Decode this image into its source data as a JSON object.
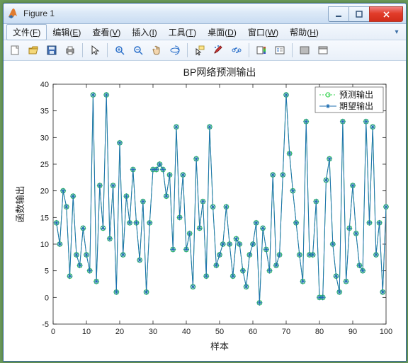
{
  "window": {
    "title": "Figure 1"
  },
  "menu": {
    "file": {
      "label": "文件",
      "accel": "F"
    },
    "edit": {
      "label": "编辑",
      "accel": "E"
    },
    "view": {
      "label": "查看",
      "accel": "V"
    },
    "insert": {
      "label": "插入",
      "accel": "I"
    },
    "tools": {
      "label": "工具",
      "accel": "T"
    },
    "desktop": {
      "label": "桌面",
      "accel": "D"
    },
    "window": {
      "label": "窗口",
      "accel": "W"
    },
    "help": {
      "label": "帮助",
      "accel": "H"
    }
  },
  "toolbar": {
    "new": "new-figure",
    "open": "open-file",
    "save": "save",
    "print": "print",
    "pointer": "pointer",
    "zoomin": "zoom-in",
    "zoomout": "zoom-out",
    "pan": "pan",
    "rotate": "rotate-3d",
    "datacursor": "data-cursor",
    "brush": "brush",
    "link": "link-plots",
    "colorbar": "insert-colorbar",
    "legend": "insert-legend",
    "hide": "hide-tools",
    "dock": "dock-figure"
  },
  "chart_data": {
    "type": "line",
    "title": "BP网络预测输出",
    "xlabel": "样本",
    "ylabel": "函数输出",
    "xlim": [
      0,
      100
    ],
    "ylim": [
      -5,
      40
    ],
    "xticks": [
      0,
      10,
      20,
      30,
      40,
      50,
      60,
      70,
      80,
      90,
      100
    ],
    "yticks": [
      -5,
      0,
      5,
      10,
      15,
      20,
      25,
      30,
      35,
      40
    ],
    "legend": {
      "position": "northeast",
      "entries": [
        "预测输出",
        "期望输出"
      ]
    },
    "x": [
      1,
      2,
      3,
      4,
      5,
      6,
      7,
      8,
      9,
      10,
      11,
      12,
      13,
      14,
      15,
      16,
      17,
      18,
      19,
      20,
      21,
      22,
      23,
      24,
      25,
      26,
      27,
      28,
      29,
      30,
      31,
      32,
      33,
      34,
      35,
      36,
      37,
      38,
      39,
      40,
      41,
      42,
      43,
      44,
      45,
      46,
      47,
      48,
      49,
      50,
      51,
      52,
      53,
      54,
      55,
      56,
      57,
      58,
      59,
      60,
      61,
      62,
      63,
      64,
      65,
      66,
      67,
      68,
      69,
      70,
      71,
      72,
      73,
      74,
      75,
      76,
      77,
      78,
      79,
      80,
      81,
      82,
      83,
      84,
      85,
      86,
      87,
      88,
      89,
      90,
      91,
      92,
      93,
      94,
      95,
      96,
      97,
      98,
      99,
      100
    ],
    "series": [
      {
        "name": "预测输出",
        "marker": "o",
        "color": "#39d353",
        "values": [
          14,
          10,
          20,
          17,
          4,
          19,
          8,
          6,
          13,
          8,
          5,
          38,
          3,
          21,
          13,
          38,
          11,
          21,
          1,
          29,
          8,
          19,
          14,
          24,
          14,
          7,
          18,
          1,
          14,
          24,
          24,
          25,
          24,
          19,
          23,
          9,
          32,
          15,
          23,
          9,
          12,
          2,
          26,
          13,
          18,
          4,
          32,
          17,
          6,
          8,
          10,
          17,
          10,
          4,
          11,
          10,
          5,
          2,
          8,
          10,
          14,
          -1,
          13,
          9,
          5,
          23,
          6,
          8,
          23,
          38,
          27,
          20,
          14,
          8,
          3,
          33,
          8,
          8,
          18,
          0,
          0,
          22,
          26,
          10,
          4,
          1,
          33,
          3,
          13,
          21,
          12,
          6,
          5,
          33,
          14,
          32,
          8,
          14,
          1,
          17
        ]
      },
      {
        "name": "期望输出",
        "marker": "*",
        "color": "#1f6fb2",
        "values": [
          14,
          10,
          20,
          17,
          4,
          19,
          8,
          6,
          13,
          8,
          5,
          38,
          3,
          21,
          13,
          38,
          11,
          21,
          1,
          29,
          8,
          19,
          14,
          24,
          14,
          7,
          18,
          1,
          14,
          24,
          24,
          25,
          24,
          19,
          23,
          9,
          32,
          15,
          23,
          9,
          12,
          2,
          26,
          13,
          18,
          4,
          32,
          17,
          6,
          8,
          10,
          17,
          10,
          4,
          11,
          10,
          5,
          2,
          8,
          10,
          14,
          -1,
          13,
          9,
          5,
          23,
          6,
          8,
          23,
          38,
          27,
          20,
          14,
          8,
          3,
          33,
          8,
          8,
          18,
          0,
          0,
          22,
          26,
          10,
          4,
          1,
          33,
          3,
          13,
          21,
          12,
          6,
          5,
          33,
          14,
          32,
          8,
          14,
          1,
          17
        ]
      }
    ]
  }
}
